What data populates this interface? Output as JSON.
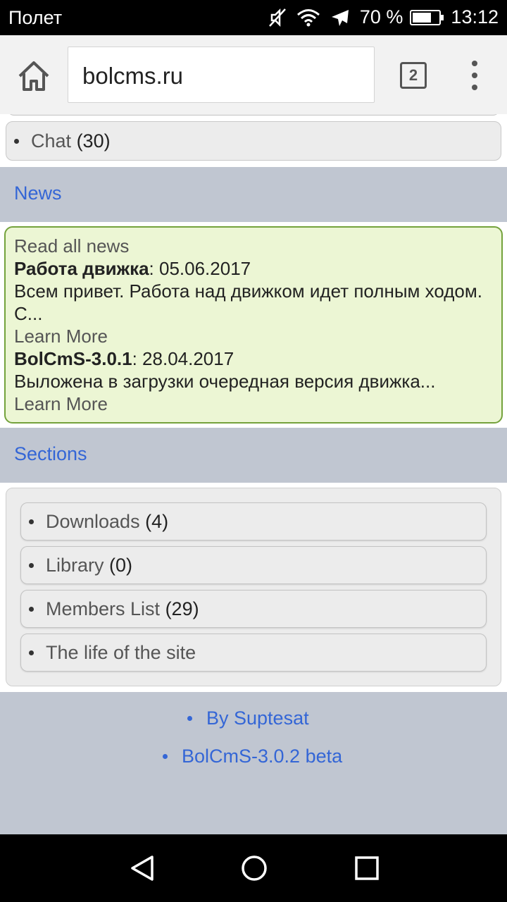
{
  "status_bar": {
    "carrier": "Полет",
    "battery_percent": "70 %",
    "battery_level": 0.7,
    "time": "13:12",
    "icons": [
      "mute-icon",
      "wifi-icon",
      "airplane-icon",
      "battery-icon"
    ]
  },
  "browser": {
    "url": "bolcms.ru",
    "tab_count": "2",
    "icons": [
      "home-icon",
      "tabs-icon",
      "overflow-menu-icon"
    ]
  },
  "chat": {
    "label": "Chat",
    "count": "(30)"
  },
  "news": {
    "header": "News",
    "read_all": "Read all news",
    "items": [
      {
        "title": "Работа движка",
        "date": ": 05.06.2017",
        "excerpt": "Всем привет. Работа над движком идет полным ходом. С...",
        "more": "Learn More"
      },
      {
        "title": "BolCmS-3.0.1",
        "date": ": 28.04.2017",
        "excerpt": "Выложена в загрузки очередная версия движка...",
        "more": "Learn More"
      }
    ]
  },
  "sections": {
    "header": "Sections",
    "items": [
      {
        "label": "Downloads",
        "count": "(4)"
      },
      {
        "label": "Library",
        "count": "(0)"
      },
      {
        "label": "Members List",
        "count": "(29)"
      },
      {
        "label": "The life of the site",
        "count": ""
      }
    ]
  },
  "footer": {
    "links": [
      "By Suptesat",
      "BolCmS-3.0.2 beta"
    ]
  },
  "nav_bar": {
    "icons": [
      "back-icon",
      "home-circle-icon",
      "recents-icon"
    ]
  },
  "colors": {
    "link": "#3466d6",
    "header_bg": "#c0c6d1",
    "news_bg": "#ecf6d4",
    "news_border": "#74a23c"
  }
}
